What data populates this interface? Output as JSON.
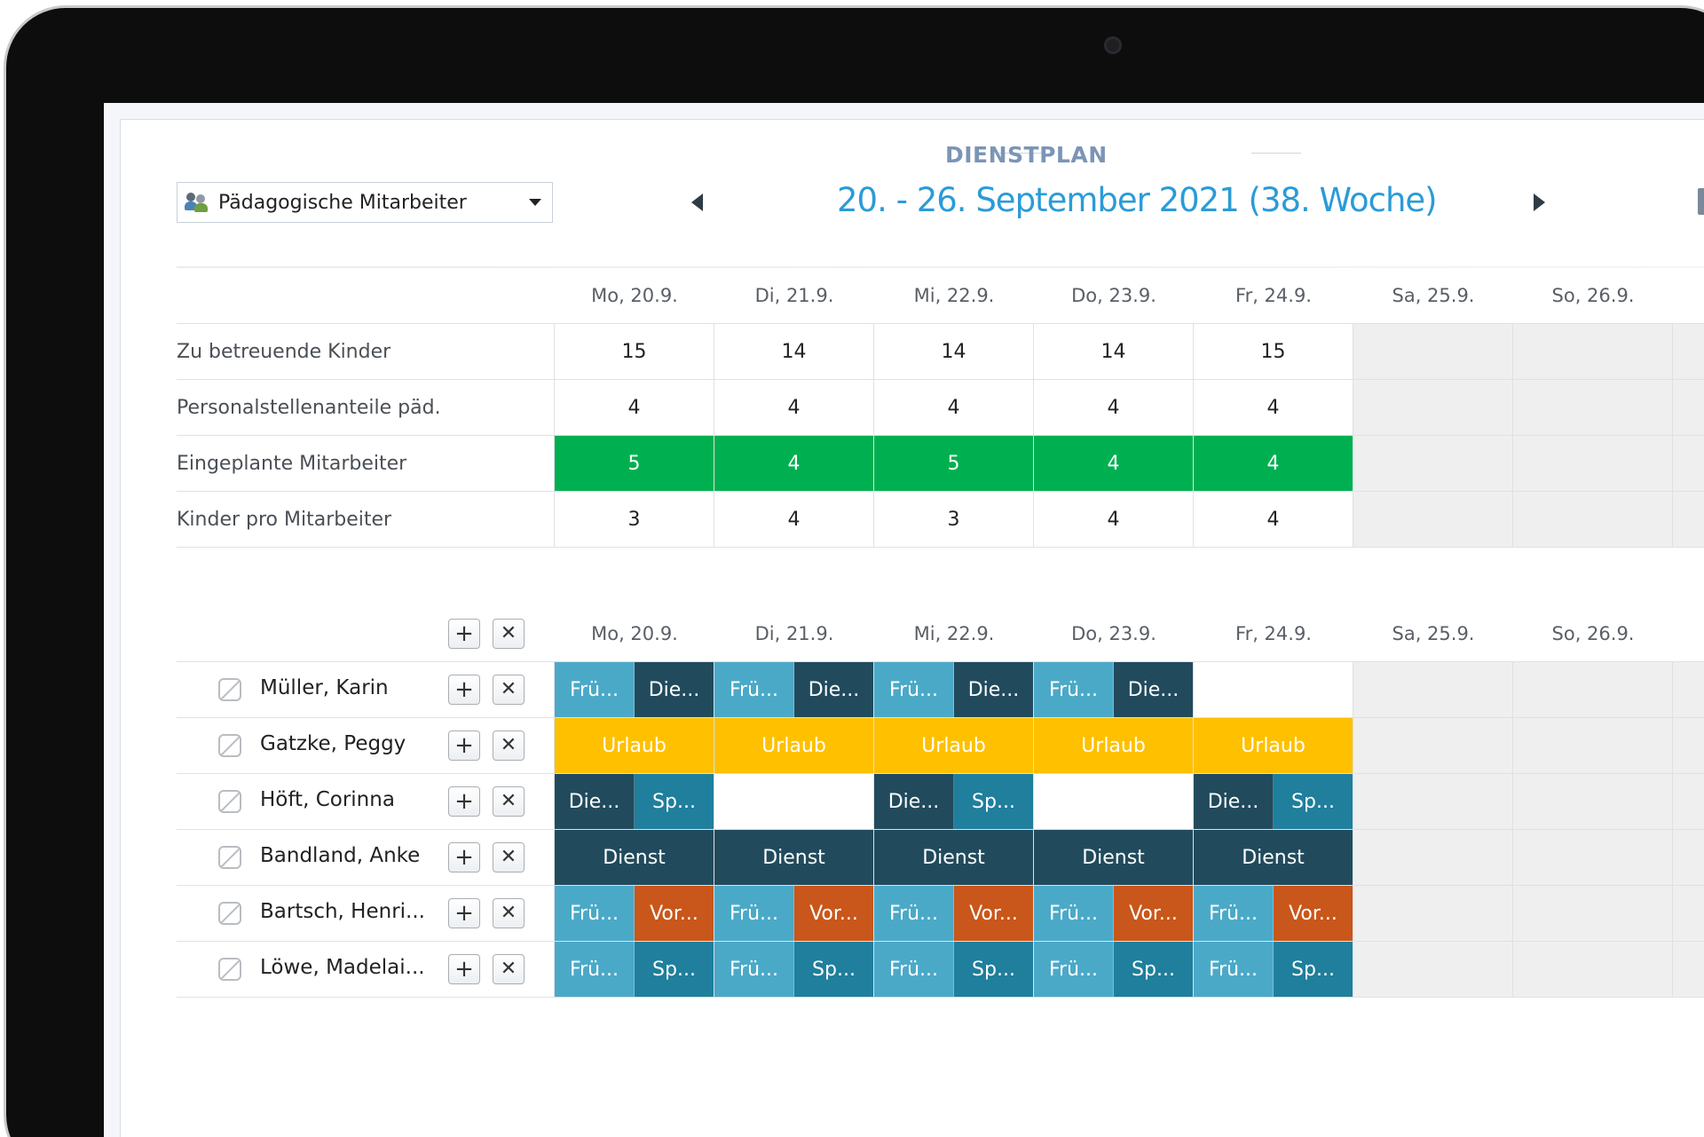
{
  "header": {
    "title": "DIENSTPLAN",
    "week": "20. - 26. September 2021  (38. Woche)",
    "group_select": "Pädagogische Mitarbeiter"
  },
  "days": [
    "Mo, 20.9.",
    "Di, 21.9.",
    "Mi, 22.9.",
    "Do, 23.9.",
    "Fr, 24.9.",
    "Sa, 25.9.",
    "So, 26.9."
  ],
  "summary": {
    "rows": [
      {
        "label": "Zu betreuende Kinder",
        "values": [
          "15",
          "14",
          "14",
          "14",
          "15",
          "",
          ""
        ]
      },
      {
        "label": "Personalstellenanteile päd.",
        "values": [
          "4",
          "4",
          "4",
          "4",
          "4",
          "",
          ""
        ]
      },
      {
        "label": "Eingeplante Mitarbeiter",
        "values": [
          "5",
          "4",
          "5",
          "4",
          "4",
          "",
          ""
        ],
        "status_color": "#00b050"
      },
      {
        "label": "Kinder pro Mitarbeiter",
        "values": [
          "3",
          "4",
          "3",
          "4",
          "4",
          "",
          ""
        ]
      }
    ]
  },
  "schedule": {
    "add_label": "+",
    "remove_label": "✕",
    "employees": [
      {
        "name": "Müller, Karin"
      },
      {
        "name": "Gatzke, Peggy"
      },
      {
        "name": "Höft, Corinna"
      },
      {
        "name": "Bandland, Anke"
      },
      {
        "name": "Bartsch, Henri..."
      },
      {
        "name": "Löwe, Madelai..."
      }
    ],
    "shifts": {
      "fru": "Frü...",
      "die": "Die...",
      "sp": "Sp...",
      "vor": "Vor...",
      "urlaub": "Urlaub",
      "dienst": "Dienst"
    }
  },
  "colors": {
    "accent_blue": "#2b9bd7",
    "ok_green": "#00b050",
    "fruh": "#4ba9c8",
    "dienst": "#214b5d",
    "spaet": "#1f7f9c",
    "vor": "#c9561a",
    "urlaub": "#ffc000"
  }
}
